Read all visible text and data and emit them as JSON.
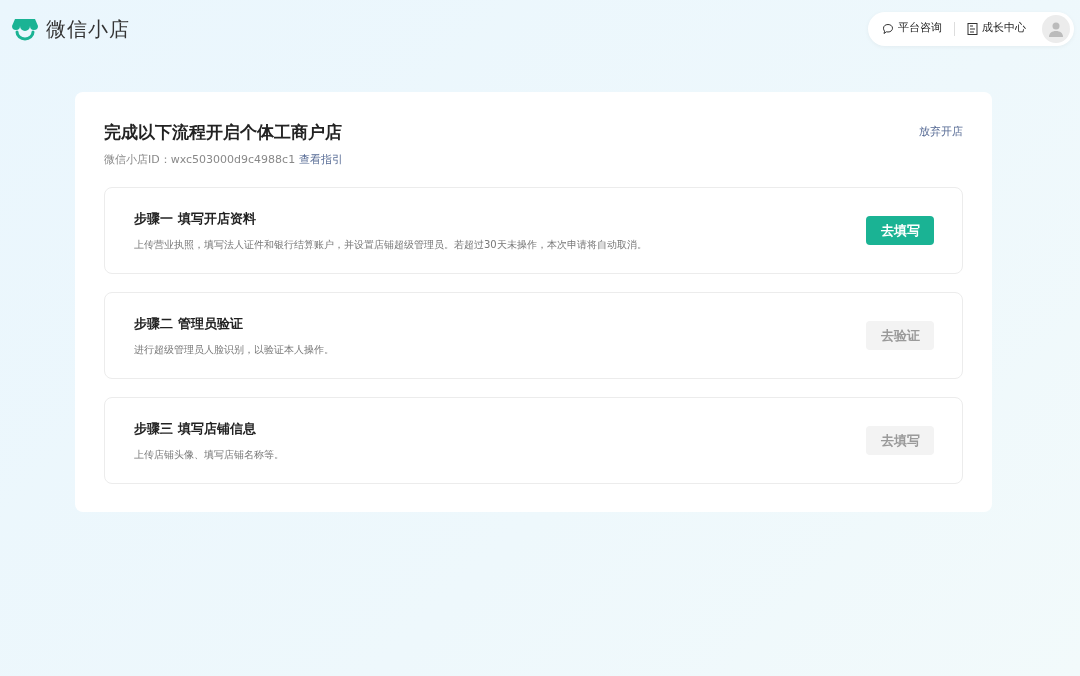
{
  "header": {
    "brand": "微信小店",
    "actions": [
      {
        "kind": "consult",
        "label": "平台咨询"
      },
      {
        "kind": "growth",
        "label": "成长中心"
      }
    ]
  },
  "panel": {
    "title": "完成以下流程开启个体工商户店",
    "abandon": "放弃开店",
    "id_label": "微信小店ID：",
    "id_value": "wxc503000d9c4988c1",
    "guide_link": "查看指引",
    "steps": [
      {
        "title": "步骤一 填写开店资料",
        "description": "上传营业执照，填写法人证件和银行结算账户，并设置店铺超级管理员。若超过30天未操作，本次申请将自动取消。",
        "button": "去填写",
        "disabled": false
      },
      {
        "title": "步骤二 管理员验证",
        "description": "进行超级管理员人脸识别，以验证本人操作。",
        "button": "去验证",
        "disabled": true
      },
      {
        "title": "步骤三 填写店铺信息",
        "description": "上传店铺头像、填写店铺名称等。",
        "button": "去填写",
        "disabled": true
      }
    ]
  }
}
